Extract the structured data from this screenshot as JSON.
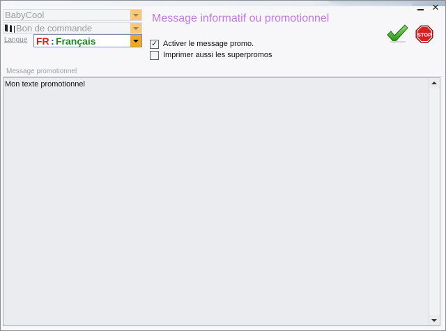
{
  "window": {
    "minimize_icon": "minimize-icon",
    "close_symbol": "✕"
  },
  "selectors": {
    "store": "BabyCool",
    "document_type": "Bon de commande",
    "language_label": "Langue",
    "language": {
      "code": "FR",
      "separator": ":",
      "name": "Français"
    }
  },
  "form": {
    "title": "Message informatif ou promotionnel",
    "activate_promo": {
      "label": "Activer le message promo.",
      "checked": true
    },
    "print_superpromos": {
      "label": "Imprimer aussi les superpromos",
      "checked": false
    }
  },
  "actions": {
    "ok_icon": "checkmark-icon",
    "stop_icon": "stop-sign-icon",
    "stop_text": "STOP"
  },
  "message": {
    "section_label": "Message promotionnel",
    "text": "Mon texte promotionnel"
  },
  "colors": {
    "title": "#c07ae0",
    "lang_code": "#e01b1b",
    "lang_name": "#1f8a1f",
    "combo_arrow": "#f3a621"
  }
}
